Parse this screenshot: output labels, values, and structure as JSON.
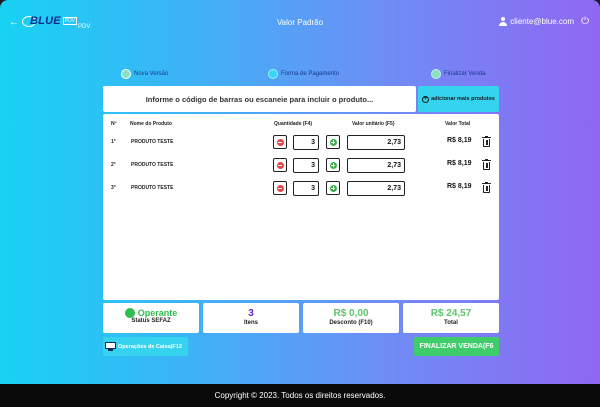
{
  "header": {
    "back_label": "←",
    "logo_name": "BLUE",
    "logo_sub": "PDV",
    "pdv_label": "PDV",
    "title": "Valor Padrão",
    "user_email": "cliente@blue.com",
    "power_label": "⏻"
  },
  "steps": [
    {
      "label": "Nova Versão"
    },
    {
      "label": "Forma de Pagamento"
    },
    {
      "label": "Finalizar Venda"
    }
  ],
  "barcode": {
    "prompt": "Informe o código de barras ou escaneie para incluir o produto..."
  },
  "add_more": {
    "label": "adicionar mais produtos"
  },
  "table": {
    "headers": {
      "num": "Nº",
      "name": "Nome do Produto",
      "qty": "Quantidade (F4)",
      "unit": "Valor unitário (F5)",
      "total": "Valor Total"
    },
    "rows": [
      {
        "num": "1°",
        "name": "PRODUTO TESTE",
        "qty": "3",
        "unit": "2,73",
        "total": "R$ 8,19"
      },
      {
        "num": "2°",
        "name": "PRODUTO TESTE",
        "qty": "3",
        "unit": "2,73",
        "total": "R$ 8,19"
      },
      {
        "num": "3°",
        "name": "PRODUTO TESTE",
        "qty": "3",
        "unit": "2,73",
        "total": "R$ 8,19"
      }
    ]
  },
  "summary": {
    "status": {
      "value": "Operante",
      "label": "Status SEFAZ",
      "color": "#2fbf4d"
    },
    "items": {
      "value": "3",
      "label": "Itens",
      "color": "#6a1fd0"
    },
    "discount": {
      "value": "R$ 0,00",
      "label": "Desconto (F10)",
      "color": "#5cc46a"
    },
    "total": {
      "value": "R$ 24,57",
      "label": "Total",
      "color": "#5cc46a"
    }
  },
  "buttons": {
    "ops": "Operações de Caixa(F12",
    "finalize": "FINALIZAR VENDA(F6"
  },
  "footer": {
    "text": "Copyright © 2023. Todos os direitos reservados."
  }
}
